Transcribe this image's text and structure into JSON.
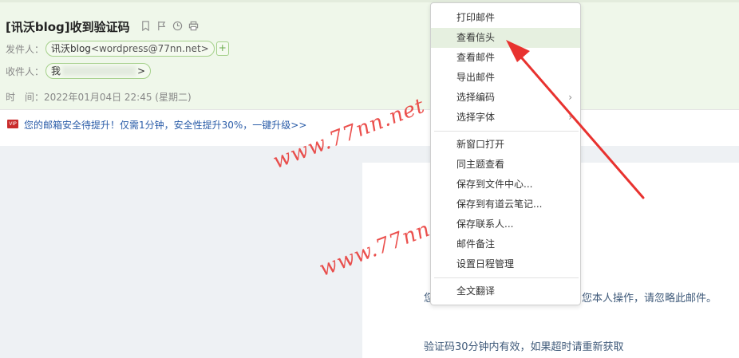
{
  "email": {
    "subject": "[讯沃blog]收到验证码",
    "from_label": "发件人：",
    "from_name": "讯沃blog",
    "from_addr": "<wordpress@77nn.net>",
    "add_contact": "+",
    "to_label": "收件人：",
    "to_name": "我",
    "to_suffix": ">",
    "time_label": "时　间：",
    "time_value": "2022年01月04日 22:45 (星期二)"
  },
  "toolbar_icons": [
    "bookmark-icon",
    "flag-icon",
    "clock-icon",
    "print-icon"
  ],
  "security_bar": {
    "badge": "VIP",
    "text": "您的邮箱安全待提升！仅需1分钟，安全性提升30%，一键升级>>"
  },
  "body": {
    "line1_left": "您",
    "line1_right": "您本人操作，请忽略此邮件。",
    "line2": "验证码30分钟内有效，如果超时请重新获取"
  },
  "watermarks": [
    "www.77nn.net",
    "www.77nn.net"
  ],
  "context_menu": {
    "items": [
      {
        "label": "打印邮件"
      },
      {
        "label": "查看信头",
        "active": true
      },
      {
        "label": "查看邮件"
      },
      {
        "label": "导出邮件"
      },
      {
        "label": "选择编码",
        "submenu": true
      },
      {
        "label": "选择字体",
        "submenu": true
      },
      {
        "label": "新窗口打开"
      },
      {
        "label": "同主题查看"
      },
      {
        "label": "保存到文件中心..."
      },
      {
        "label": "保存到有道云笔记..."
      },
      {
        "label": "保存联系人..."
      },
      {
        "label": "邮件备注"
      },
      {
        "label": "设置日程管理"
      },
      {
        "label": "全文翻译"
      }
    ],
    "submenu_arrow": "›"
  },
  "colors": {
    "header_bg": "#eff7ea",
    "menu_active_bg": "#e6f0e0",
    "annotation_arrow": "#e8322f",
    "link": "#2a5ca8"
  }
}
